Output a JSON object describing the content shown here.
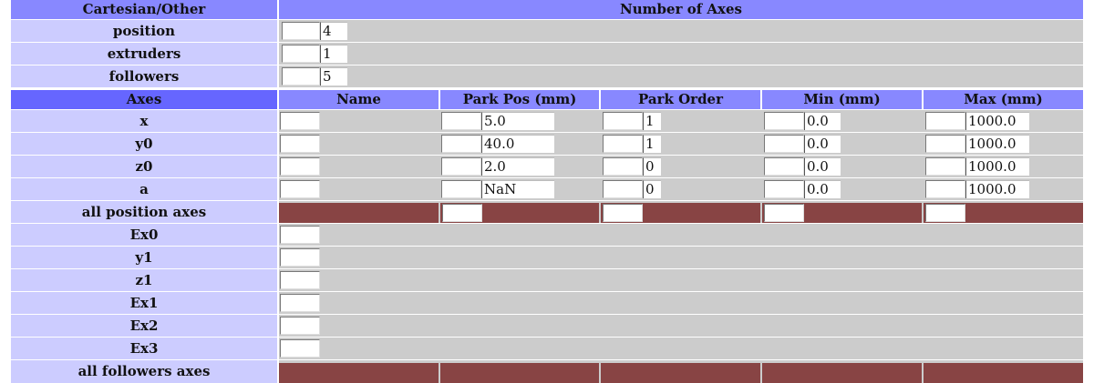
{
  "header": {
    "type_label": "Cartesian/Other",
    "num_axes_label": "Number of Axes"
  },
  "counts": [
    {
      "label": "position",
      "value": "4"
    },
    {
      "label": "extruders",
      "value": "1"
    },
    {
      "label": "followers",
      "value": "5"
    }
  ],
  "axes_header": {
    "axes": "Axes",
    "name": "Name",
    "park_pos": "Park Pos (mm)",
    "park_order": "Park Order",
    "min": "Min (mm)",
    "max": "Max (mm)"
  },
  "axes": [
    {
      "label": "x",
      "park_pos": "5.0",
      "park_order": "1",
      "min": "0.0",
      "max": "1000.0"
    },
    {
      "label": "y0",
      "park_pos": "40.0",
      "park_order": "1",
      "min": "0.0",
      "max": "1000.0"
    },
    {
      "label": "z0",
      "park_pos": "2.0",
      "park_order": "0",
      "min": "0.0",
      "max": "1000.0"
    },
    {
      "label": "a",
      "park_pos": "NaN",
      "park_order": "0",
      "min": "0.0",
      "max": "1000.0"
    }
  ],
  "all_position_label": "all position axes",
  "followers": [
    "Ex0",
    "y1",
    "z1",
    "Ex1",
    "Ex2",
    "Ex3"
  ],
  "all_followers_label": "all followers axes",
  "colors": {
    "header_light": "#8888ff",
    "header_dark": "#6666ff",
    "label_bg": "#ccccff",
    "grid_bg": "#cccccc",
    "group_row": "#884444"
  }
}
